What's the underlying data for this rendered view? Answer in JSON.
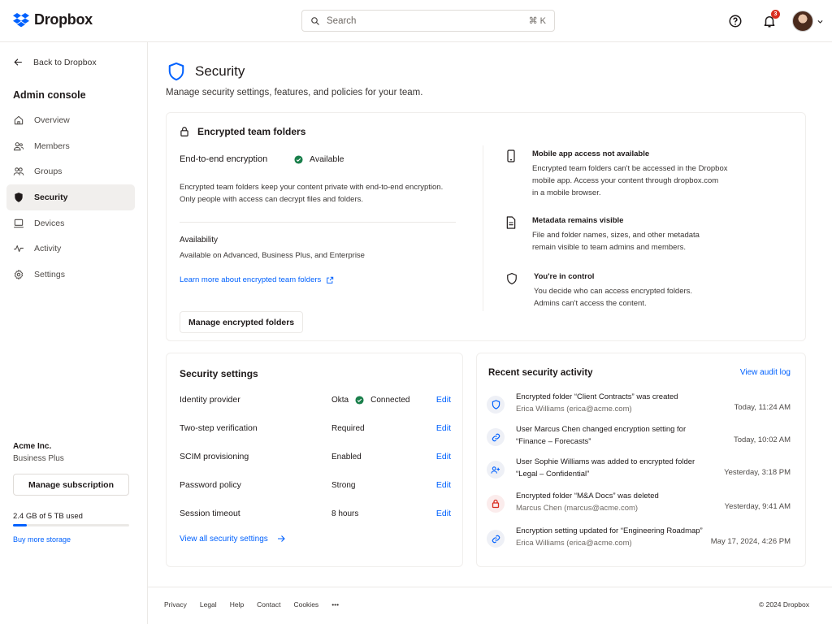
{
  "app": {
    "name": "Dropbox",
    "brand_color": "#0061fe"
  },
  "search": {
    "placeholder": "Search",
    "shortcut": "⌘ K"
  },
  "topbar": {
    "notification_count": "3"
  },
  "sidebar": {
    "back_label": "Back to Dropbox",
    "section_title": "Admin console",
    "items": [
      {
        "label": "Overview",
        "icon": "home-icon"
      },
      {
        "label": "Members",
        "icon": "members-icon"
      },
      {
        "label": "Groups",
        "icon": "groups-icon"
      },
      {
        "label": "Security",
        "icon": "shield-icon",
        "active": true
      },
      {
        "label": "Devices",
        "icon": "laptop-icon"
      },
      {
        "label": "Activity",
        "icon": "activity-icon"
      },
      {
        "label": "Settings",
        "icon": "gear-icon"
      }
    ],
    "org_name": "Acme Inc.",
    "org_plan": "Business Plus",
    "manage_subscription": "Manage subscription",
    "usage_text": "2.4 GB of 5 TB used",
    "usage_fraction": 0.12,
    "buy_storage": "Buy more storage"
  },
  "page": {
    "title": "Security",
    "subtitle": "Manage security settings, features, and policies for your team."
  },
  "encrypted": {
    "title": "Encrypted team folders",
    "e2e_label": "End-to-end encryption",
    "status": "Available",
    "status_color": "#1a7f4b",
    "desc_line1": "Encrypted team folders keep your content private with end-to-end encryption.",
    "desc_line2": "Only people with access can decrypt files and folders.",
    "availability_label": "Availability",
    "availability_value": "Available on Advanced, Business Plus, and Enterprise",
    "learn_more": "Learn more about encrypted team folders",
    "manage_button": "Manage encrypted folders",
    "features": [
      {
        "title": "Mobile app access not available",
        "lines": [
          "Encrypted team folders can't be accessed in the Dropbox",
          "mobile app. Access your content through dropbox.com",
          "in a mobile browser."
        ],
        "icon": "mobile-icon"
      },
      {
        "title": "Metadata remains visible",
        "lines": [
          "File and folder names, sizes, and other metadata",
          "remain visible to team admins and members."
        ],
        "icon": "document-icon"
      },
      {
        "title": "You're in control",
        "lines": [
          "You decide who can access encrypted folders.",
          "Admins can't access the content."
        ],
        "icon": "shield-outline-icon"
      }
    ]
  },
  "security_settings": {
    "title": "Security settings",
    "rows": [
      {
        "label": "Identity provider",
        "value": "Okta",
        "status": "Connected",
        "edit": "Edit"
      },
      {
        "label": "Two-step verification",
        "value": "Required",
        "edit": "Edit"
      },
      {
        "label": "SCIM provisioning",
        "value": "Enabled",
        "edit": "Edit"
      },
      {
        "label": "Password policy",
        "value": "Strong",
        "edit": "Edit"
      },
      {
        "label": "Session timeout",
        "value": "8 hours",
        "edit": "Edit"
      }
    ],
    "view_all": "View all security settings"
  },
  "activity": {
    "title": "Recent security activity",
    "audit_link": "View audit log",
    "items": [
      {
        "line1": "Encrypted folder “Client Contracts” was created",
        "line2": "Erica Williams (erica@acme.com)",
        "time": "Today, 11:24 AM",
        "icon": "shield-icon",
        "sub": true
      },
      {
        "line1": "User Marcus Chen changed encryption setting for",
        "line2": "“Finance – Forecasts”",
        "time": "Today, 10:02 AM",
        "icon": "link-icon",
        "sub": false
      },
      {
        "line1": "User Sophie Williams was added to encrypted folder",
        "line2": "“Legal – Confidential”",
        "time": "Yesterday, 3:18 PM",
        "icon": "user-add-icon",
        "sub": false
      },
      {
        "line1": "Encrypted folder “M&A Docs” was deleted",
        "line2": "Marcus Chen (marcus@acme.com)",
        "time": "Yesterday, 9:41 AM",
        "icon": "lock-icon",
        "sub": true
      },
      {
        "line1": "Encryption setting updated for “Engineering Roadmap”",
        "line2": "Erica Williams (erica@acme.com)",
        "time": "May 17, 2024, 4:26 PM",
        "icon": "link-icon",
        "sub": true
      }
    ]
  },
  "footer": {
    "links": [
      "Privacy",
      "Legal",
      "Help",
      "Contact",
      "Cookies",
      "•••"
    ],
    "copyright": "© 2024 Dropbox"
  }
}
